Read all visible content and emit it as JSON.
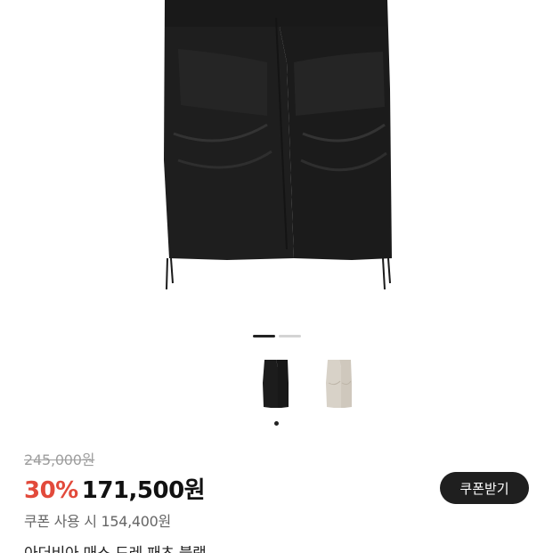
{
  "gallery": {
    "pager_count": 2,
    "active_index": 0,
    "color_options": [
      {
        "name": "black-icon",
        "color": "#1c1c1c"
      },
      {
        "name": "beige-icon",
        "color": "#d8d2c8"
      }
    ],
    "selected_color_index": 0
  },
  "price": {
    "original": "245,000원",
    "discount_rate": "30%",
    "sale_price": "171,500원",
    "coupon_note": "쿠폰 사용 시 154,400원"
  },
  "coupon_button": {
    "label": "쿠폰받기"
  },
  "product": {
    "name_partial": "아더비아 매스 드레 패츠 블랙"
  },
  "colors": {
    "accent_red": "#e24a3b",
    "button_dark": "#1f1f1f"
  }
}
